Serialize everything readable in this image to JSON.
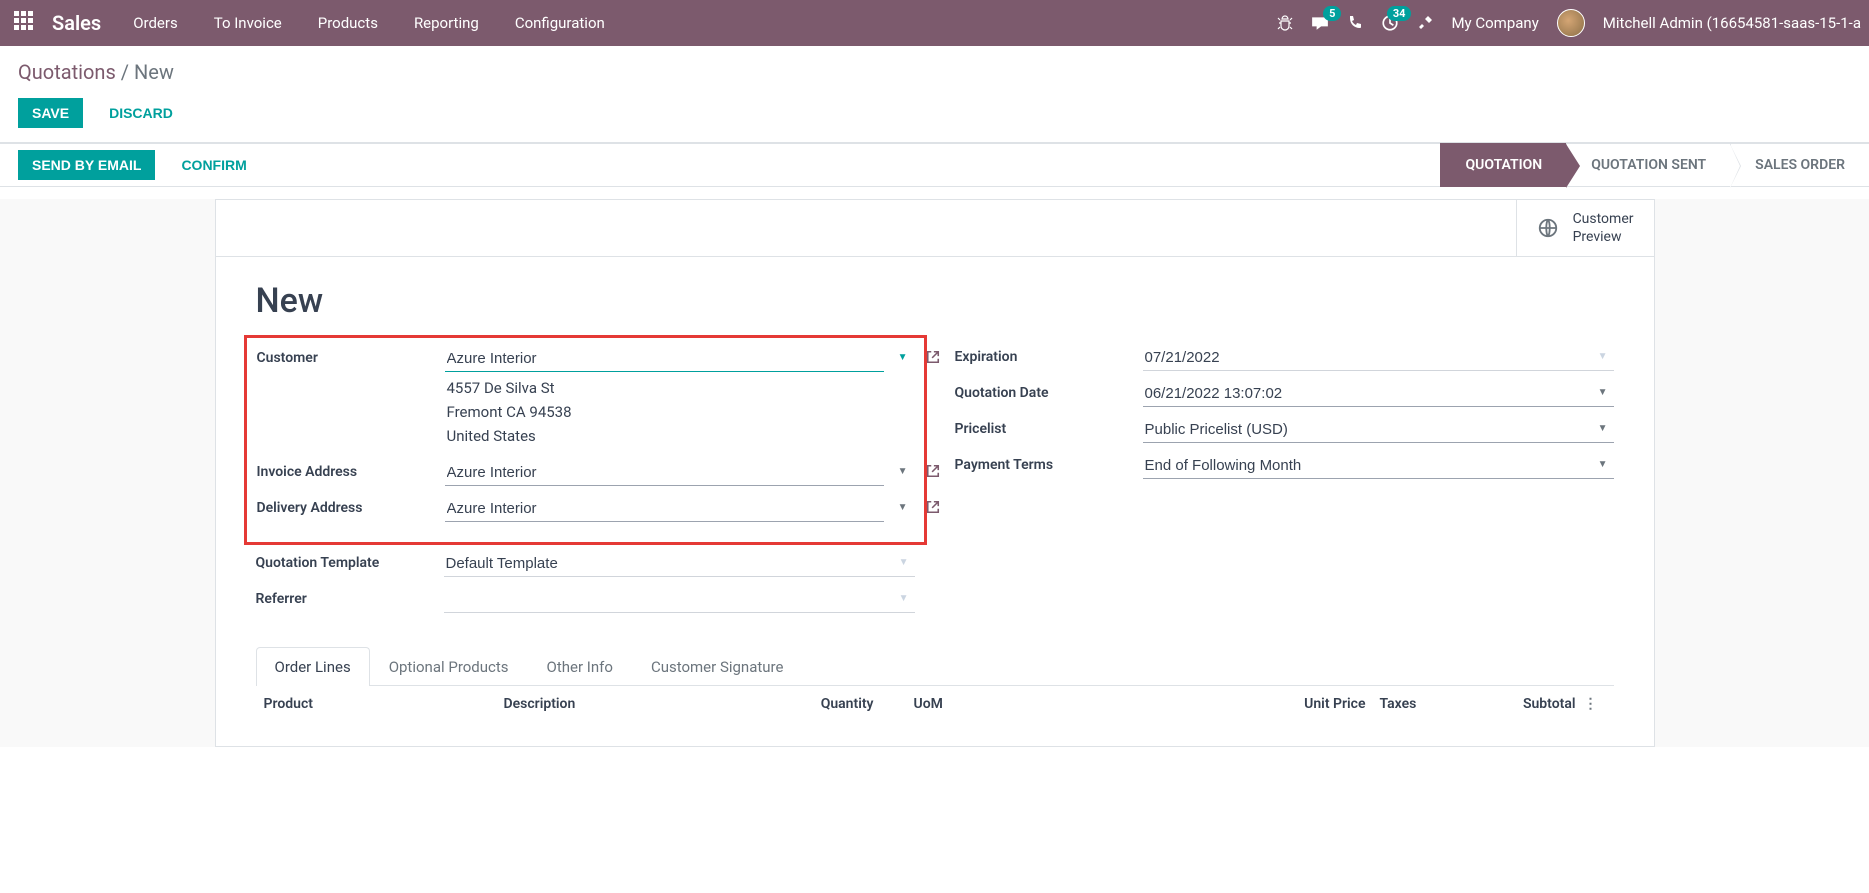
{
  "nav": {
    "brand": "Sales",
    "links": [
      "Orders",
      "To Invoice",
      "Products",
      "Reporting",
      "Configuration"
    ],
    "messages_badge": "5",
    "activities_badge": "34",
    "company": "My Company",
    "user": "Mitchell Admin (16654581-saas-15-1-a"
  },
  "breadcrumb": {
    "root": "Quotations",
    "sep": " / ",
    "current": "New"
  },
  "buttons": {
    "save": "SAVE",
    "discard": "DISCARD",
    "send_email": "SEND BY EMAIL",
    "confirm": "CONFIRM"
  },
  "steps": [
    "QUOTATION",
    "QUOTATION SENT",
    "SALES ORDER"
  ],
  "preview": {
    "line1": "Customer",
    "line2": "Preview"
  },
  "form": {
    "title": "New",
    "left": {
      "customer_label": "Customer",
      "customer_value": "Azure Interior",
      "address": [
        "4557 De Silva St",
        "Fremont CA 94538",
        "United States"
      ],
      "invoice_label": "Invoice Address",
      "invoice_value": "Azure Interior",
      "delivery_label": "Delivery Address",
      "delivery_value": "Azure Interior",
      "template_label": "Quotation Template",
      "template_value": "Default Template",
      "referrer_label": "Referrer",
      "referrer_value": ""
    },
    "right": {
      "expiration_label": "Expiration",
      "expiration_value": "07/21/2022",
      "date_label": "Quotation Date",
      "date_value": "06/21/2022 13:07:02",
      "pricelist_label": "Pricelist",
      "pricelist_value": "Public Pricelist (USD)",
      "terms_label": "Payment Terms",
      "terms_value": "End of Following Month"
    }
  },
  "tabs": [
    "Order Lines",
    "Optional Products",
    "Other Info",
    "Customer Signature"
  ],
  "columns": {
    "product": "Product",
    "description": "Description",
    "quantity": "Quantity",
    "uom": "UoM",
    "unit_price": "Unit Price",
    "taxes": "Taxes",
    "subtotal": "Subtotal"
  }
}
